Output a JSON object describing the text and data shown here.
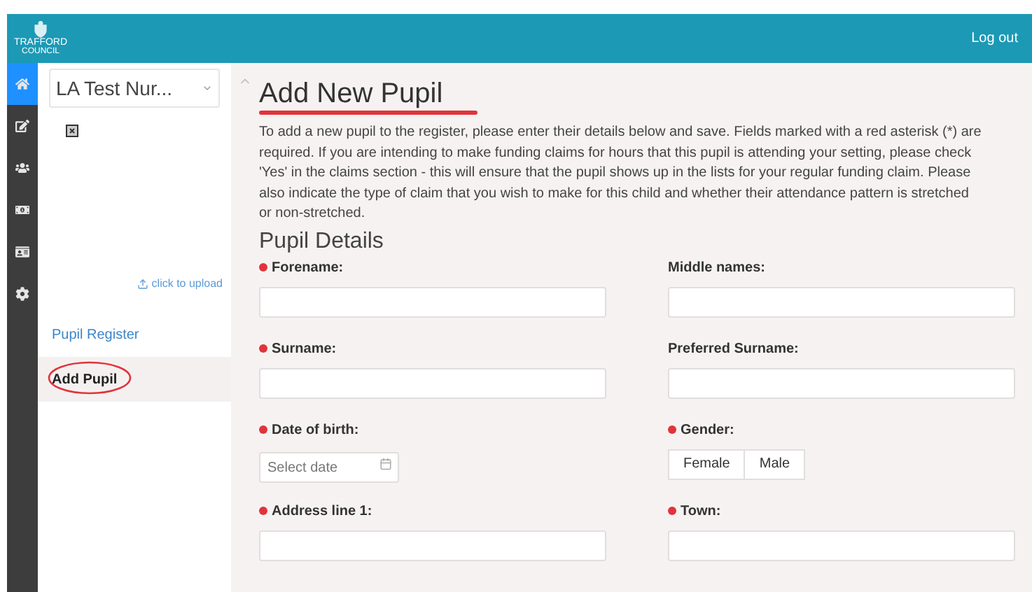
{
  "header": {
    "org": "TRAFFORD",
    "org_sub": "COUNCIL",
    "logout": "Log out"
  },
  "nav": [
    {
      "kind": "home",
      "selected": true
    },
    {
      "kind": "edit",
      "selected": false
    },
    {
      "kind": "users",
      "selected": false
    },
    {
      "kind": "money",
      "selected": false
    },
    {
      "kind": "card",
      "selected": false
    },
    {
      "kind": "settings",
      "selected": false
    }
  ],
  "setting_select": {
    "value": "LA Test Nur..."
  },
  "upload": "click to upload",
  "menu": [
    {
      "label": "Pupil Register",
      "selected": false
    },
    {
      "label": "Add Pupil",
      "selected": true
    }
  ],
  "page": {
    "title": "Add New Pupil",
    "intro_lines": [
      "To add a new pupil to the register, please enter their details below and save.  Fields marked with a red asterisk (*) are",
      "required.  If you are intending to make funding claims for hours that this pupil is attending your setting, please check",
      "'Yes' in the claims section - this will ensure that the pupil shows up in the lists for your regular funding claim.  Please",
      "also indicate the type of claim that you wish to make for this child and whether their attendance pattern is stretched",
      "or non-stretched."
    ],
    "section": "Pupil Details",
    "fields": [
      {
        "label": "Forename:",
        "required": true,
        "kind": "text"
      },
      {
        "label": "Middle names:",
        "required": false,
        "kind": "text"
      },
      {
        "label": "Surname:",
        "required": true,
        "kind": "text"
      },
      {
        "label": "Preferred Surname:",
        "required": false,
        "kind": "text"
      },
      {
        "label": "Date of birth:",
        "required": true,
        "kind": "date",
        "placeholder": "Select date"
      },
      {
        "label": "Gender:",
        "required": true,
        "kind": "toggle",
        "options": [
          {
            "label": "Female",
            "selected": false
          },
          {
            "label": "Male",
            "selected": false
          }
        ]
      },
      {
        "label": "Address line 1:",
        "required": true,
        "kind": "text"
      },
      {
        "label": "Town:",
        "required": true,
        "kind": "text"
      }
    ]
  }
}
